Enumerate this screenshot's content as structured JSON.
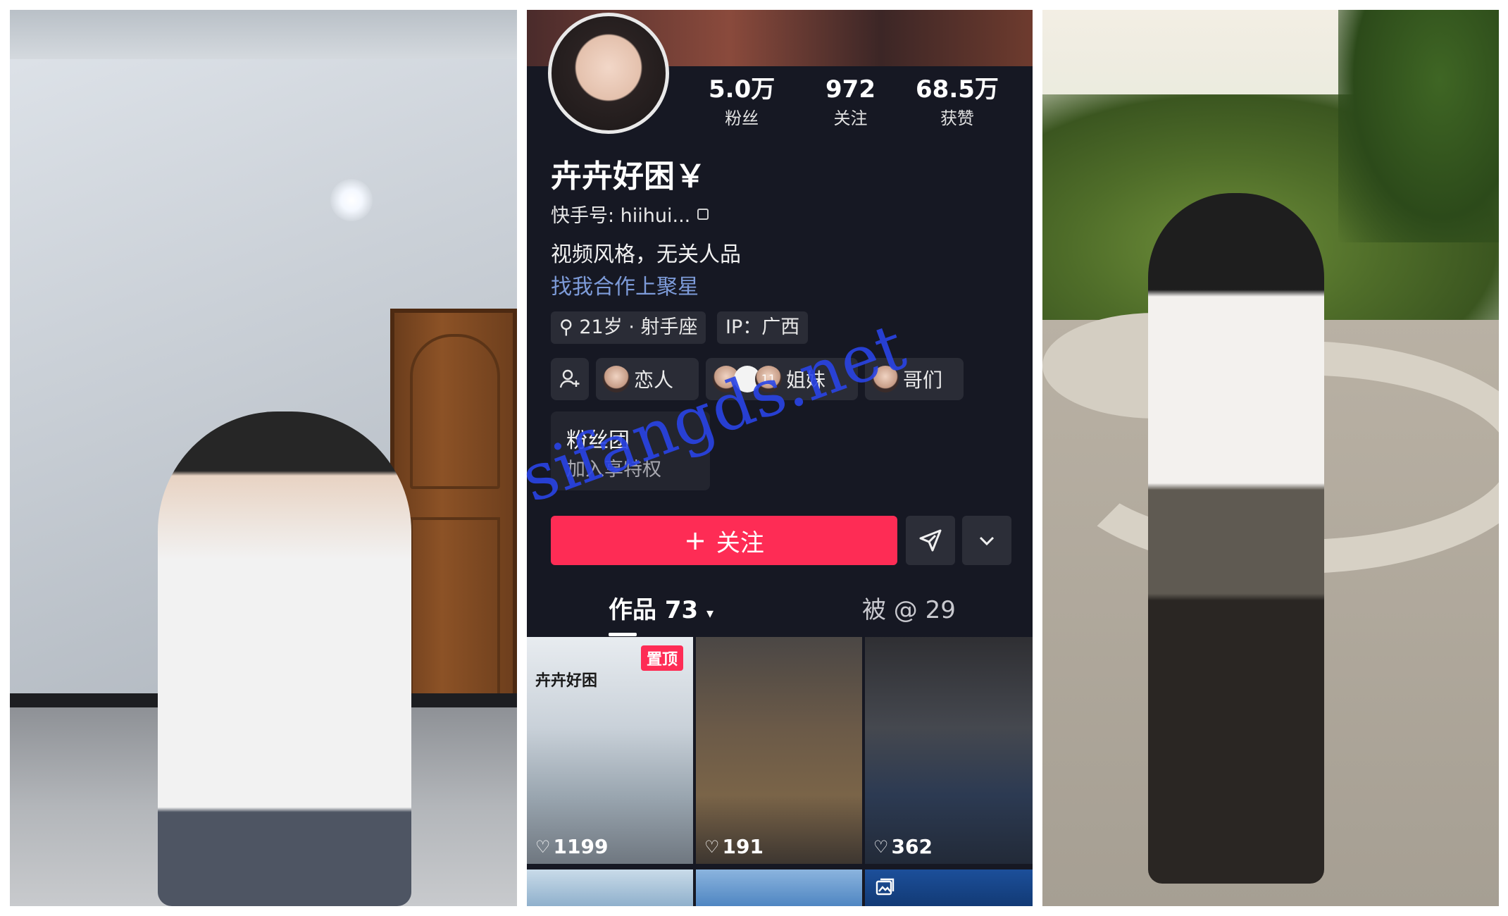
{
  "profile": {
    "stats": [
      {
        "value": "5.0万",
        "label": "粉丝"
      },
      {
        "value": "972",
        "label": "关注"
      },
      {
        "value": "68.5万",
        "label": "获赞"
      }
    ],
    "name": "卉卉好困￥",
    "kuaishou_id": "快手号: hiihui...",
    "bio": "视频风格，无关人品",
    "cooperation": "找我合作上聚星",
    "tags": [
      "21岁 · 射手座",
      "IP：广西"
    ],
    "relations": [
      "恋人",
      "姐妹",
      "哥们"
    ],
    "relation_badge": "11",
    "fan_club": {
      "title": "粉丝团",
      "subtitle": "加入享特权"
    },
    "follow_label": "关注",
    "tabs": {
      "works": "作品 73",
      "mentioned": "被 @ 29"
    },
    "videos": [
      {
        "likes": "1199",
        "pinned": "置顶",
        "caption": "卉卉好困"
      },
      {
        "likes": "191"
      },
      {
        "likes": "362"
      }
    ]
  },
  "watermark": "sifangds.net",
  "colors": {
    "accent": "#fe2c55",
    "background": "#161823",
    "link": "#7d9bd9",
    "watermark": "#2944e6"
  },
  "icons": [
    "copy-icon",
    "location-icon",
    "add-friend-icon",
    "plus-icon",
    "share-icon",
    "chevron-down-icon",
    "heart-icon",
    "gallery-icon"
  ]
}
